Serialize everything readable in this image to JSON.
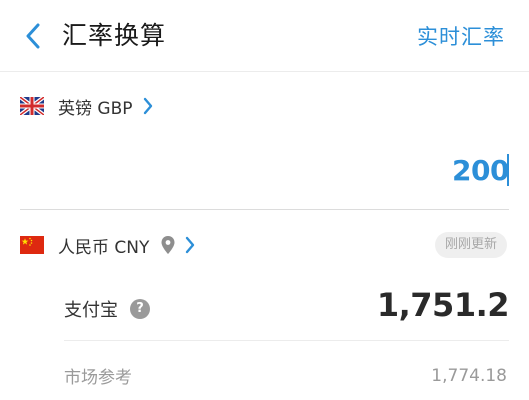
{
  "header": {
    "title": "汇率换算",
    "realtime_link": "实时汇率"
  },
  "source": {
    "currency_label": "英镑 GBP",
    "amount": "200",
    "flag_icon": "uk-flag-icon"
  },
  "target": {
    "currency_label": "人民币 CNY",
    "flag_icon": "china-flag-icon",
    "status_badge": "刚刚更新"
  },
  "rates": {
    "alipay_label": "支付宝",
    "alipay_value": "1,751.2",
    "market_label": "市场参考",
    "market_value": "1,774.18"
  },
  "colors": {
    "accent": "#2c8fd8",
    "muted_text": "#9a9a9a"
  }
}
